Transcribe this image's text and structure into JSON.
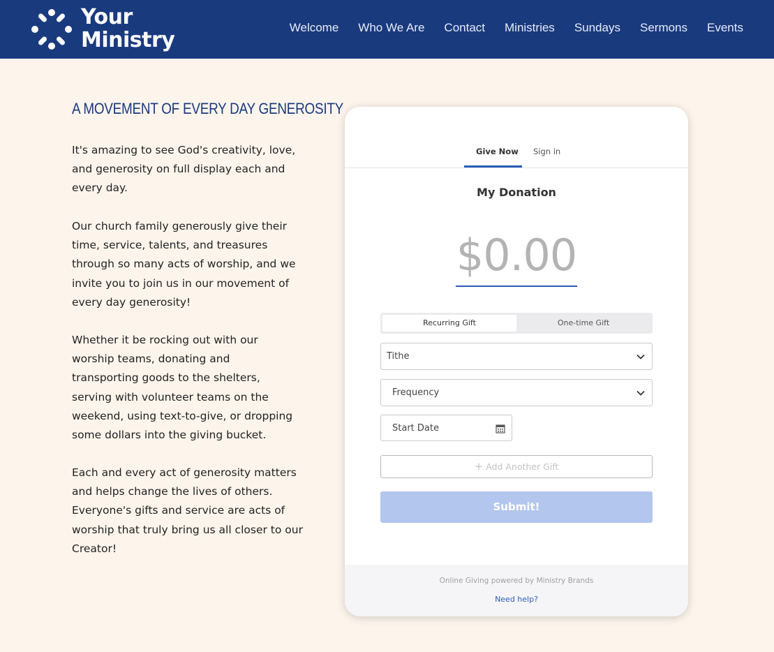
{
  "brand": {
    "line1": "Your",
    "line2": "Ministry"
  },
  "nav": [
    {
      "label": "Welcome"
    },
    {
      "label": "Who We Are"
    },
    {
      "label": "Contact"
    },
    {
      "label": "Ministries"
    },
    {
      "label": "Sundays"
    },
    {
      "label": "Sermons"
    },
    {
      "label": "Events"
    }
  ],
  "intro": {
    "heading": "A MOVEMENT OF EVERY DAY GENEROSITY",
    "paragraphs": [
      [
        "It's amazing to see God's creativity, love,",
        "and generosity on full display each and",
        "every day."
      ],
      [
        "Our church family generously give their",
        "time, service, talents, and treasures",
        "through so many acts of worship, and we",
        "invite you to join us in our movement of",
        "every day generosity!"
      ],
      [
        "Whether it be rocking out with our",
        "worship teams, donating and",
        "transporting goods to the shelters,",
        "serving with volunteer teams on the",
        "weekend, using text-to-give, or dropping",
        "some dollars into the giving bucket."
      ],
      [
        "Each and every act of generosity matters",
        "and helps change the lives of others.",
        "Everyone's gifts and service are acts of",
        "worship that truly bring us all closer to our",
        "Creator!"
      ]
    ]
  },
  "donation": {
    "tabs": {
      "give_now": "Give Now",
      "sign_in": "Sign in"
    },
    "title": "My Donation",
    "amount": "$0.00",
    "gift_type": {
      "recurring": "Recurring Gift",
      "one_time": "One-time Gift"
    },
    "fund": "Tithe",
    "frequency": "Frequency",
    "start_date": "Start Date",
    "add_gift": "Add Another Gift",
    "submit": "Submit!",
    "powered_by": "Online Giving powered by Ministry Brands",
    "help": "Need help?"
  },
  "colors": {
    "header_bg": "#1a3a7e",
    "accent": "#2b5cb8",
    "page_bg": "#fdf5ec",
    "submit_disabled": "#b3c6ee"
  }
}
